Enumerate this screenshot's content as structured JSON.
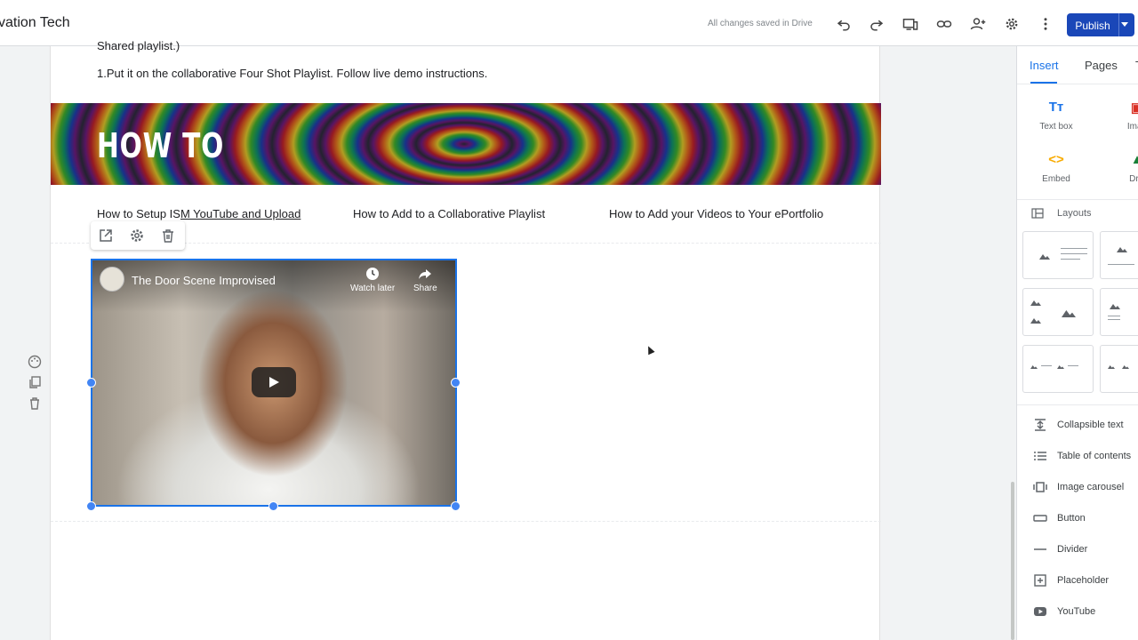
{
  "app": {
    "site_title": "vation Tech",
    "save_status": "All changes saved in Drive",
    "publish_label": "Publish"
  },
  "toolbar_icons": [
    "undo-icon",
    "redo-icon",
    "preview-icon",
    "link-icon",
    "share-icon",
    "settings-icon",
    "more-icon"
  ],
  "page": {
    "intro_line_1": "Shared playlist.)",
    "intro_line_2": "1.Put it on the collaborative Four Shot Playlist. Follow live demo instructions.",
    "banner_title": "HOW TO",
    "links": [
      {
        "prefix": "How to Setup IS",
        "underlined": "M YouTube and Upload"
      },
      {
        "prefix": "How to Add to a Collaborative Playlist",
        "underlined": ""
      },
      {
        "prefix": "How to Add your Videos to Your ePortfolio",
        "underlined": ""
      }
    ],
    "video": {
      "title": "The Door Scene Improvised",
      "watch_later": "Watch later",
      "share": "Share"
    }
  },
  "side_panel": {
    "tabs": [
      {
        "label": "Insert",
        "active": true
      },
      {
        "label": "Pages",
        "active": false
      },
      {
        "label": "T",
        "active": false
      }
    ],
    "tiles": [
      {
        "label": "Text box",
        "icon": "text-box-icon",
        "glyph": "Tт",
        "color": "#1a73e8"
      },
      {
        "label": "Imag",
        "icon": "image-icon",
        "glyph": "▣",
        "color": "#d93025"
      },
      {
        "label": "Embed",
        "icon": "embed-icon",
        "glyph": "<>",
        "color": "#f9ab00"
      },
      {
        "label": "Driv",
        "icon": "drive-icon",
        "glyph": "▲",
        "color": "#188038"
      }
    ],
    "layouts_label": "Layouts",
    "components": [
      {
        "label": "Collapsible text",
        "icon": "collapsible-text-icon"
      },
      {
        "label": "Table of contents",
        "icon": "table-of-contents-icon"
      },
      {
        "label": "Image carousel",
        "icon": "image-carousel-icon"
      },
      {
        "label": "Button",
        "icon": "button-icon"
      },
      {
        "label": "Divider",
        "icon": "divider-icon"
      },
      {
        "label": "Placeholder",
        "icon": "placeholder-icon"
      },
      {
        "label": "YouTube",
        "icon": "youtube-icon"
      }
    ]
  },
  "colors": {
    "accent": "#1a73e8",
    "publish": "#1a47b8"
  }
}
